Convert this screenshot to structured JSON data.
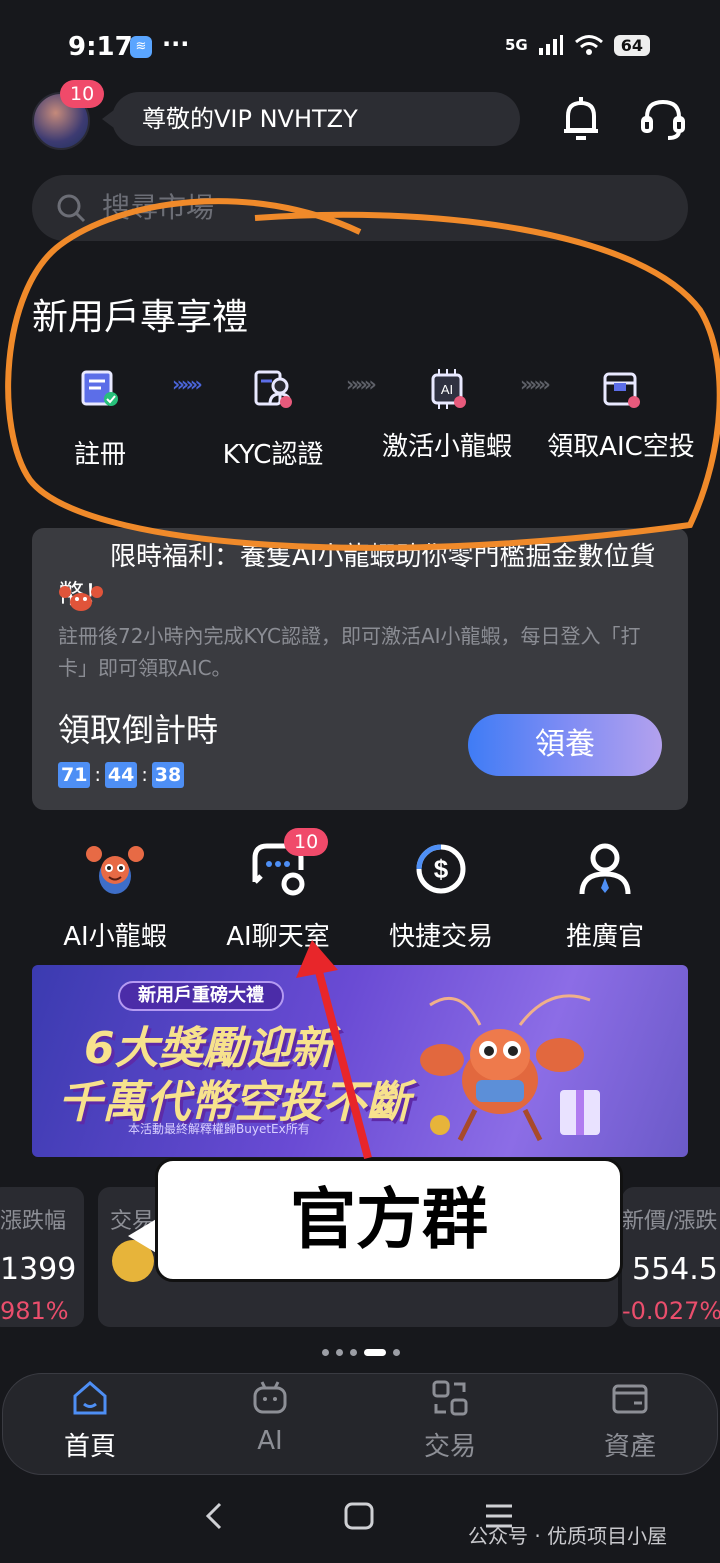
{
  "status_bar": {
    "time": "9:17",
    "app_badge": "≋",
    "more": "···",
    "network": "5G",
    "battery": "64"
  },
  "header": {
    "avatar_badge": "10",
    "greeting": "尊敬的VIP NVHTZY",
    "bell_icon": "bell-icon",
    "support_icon": "headset-icon"
  },
  "search": {
    "placeholder": "搜尋市場"
  },
  "new_user_gift": {
    "title": "新用戶專享禮",
    "steps": [
      {
        "label": "註冊",
        "icon": "register-icon"
      },
      {
        "label": "KYC認證",
        "icon": "kyc-icon"
      },
      {
        "label": "激活小龍蝦",
        "icon": "ai-chip-icon"
      },
      {
        "label": "領取AIC空投",
        "icon": "airdrop-box-icon"
      }
    ],
    "arrow": "»»»"
  },
  "promo": {
    "title": "限時福利：養隻AI小龍蝦助你零門檻掘金數位貨幣！",
    "description": "註冊後72小時內完成KYC認證，即可激活AI小龍蝦，每日登入「打卡」即可領取AIC。",
    "countdown_title": "領取倒計時",
    "countdown": {
      "h": "71",
      "m": "44",
      "s": "38",
      "sep": ":"
    },
    "button": "領養"
  },
  "features": [
    {
      "label": "AI小龍蝦",
      "icon": "lobster-icon"
    },
    {
      "label": "AI聊天室",
      "icon": "chat-room-icon",
      "badge": "10"
    },
    {
      "label": "快捷交易",
      "icon": "quick-trade-icon"
    },
    {
      "label": "推廣官",
      "icon": "promoter-icon"
    }
  ],
  "banner": {
    "tag": "新用戶重磅大禮",
    "line1": "6大獎勵迎新",
    "line2": "千萬代幣空投不斷",
    "footnote": "本活動最終解釋權歸BuyetEx所有"
  },
  "market": [
    {
      "head": "漲跌幅",
      "price": "1399",
      "pct": "981%"
    },
    {
      "head": "交易",
      "price": "",
      "pct": ""
    },
    {
      "head": "新價/漲跌",
      "price": "554.5",
      "pct": "-0.027%"
    }
  ],
  "callout": "官方群",
  "nav": [
    {
      "label": "首頁",
      "icon": "home-icon",
      "active": true
    },
    {
      "label": "AI",
      "icon": "robot-icon"
    },
    {
      "label": "交易",
      "icon": "trade-icon"
    },
    {
      "label": "資產",
      "icon": "wallet-icon"
    }
  ],
  "watermark": "公众号 · 优质项目小屋",
  "colors": {
    "accent": "#4e8ff5",
    "badge": "#f04a6a",
    "annotation_orange": "#f08a2a",
    "annotation_red": "#e8262a",
    "negative": "#ea4e6c"
  }
}
